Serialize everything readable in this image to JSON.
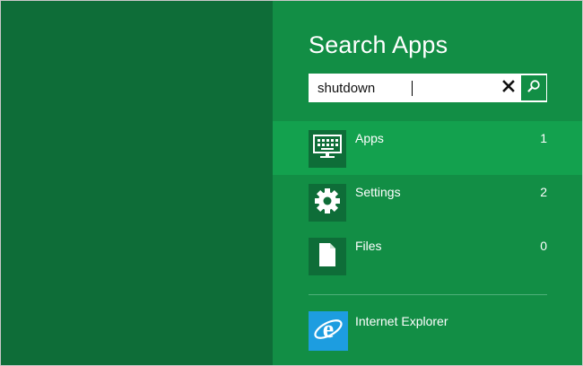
{
  "search": {
    "title": "Search Apps",
    "query": "shutdown",
    "clear_icon": "close-icon",
    "go_icon": "search-icon"
  },
  "categories": [
    {
      "label": "Apps",
      "count": "1",
      "icon": "keyboard-monitor-icon",
      "selected": true
    },
    {
      "label": "Settings",
      "count": "2",
      "icon": "gear-icon",
      "selected": false
    },
    {
      "label": "Files",
      "count": "0",
      "icon": "document-icon",
      "selected": false
    }
  ],
  "results": [
    {
      "label": "Internet Explorer",
      "icon": "internet-explorer-icon"
    }
  ],
  "colors": {
    "start_green": "#0e6d38",
    "pane_green": "#128e45",
    "selected_green": "#13a14e",
    "ie_blue": "#1d9de0"
  }
}
